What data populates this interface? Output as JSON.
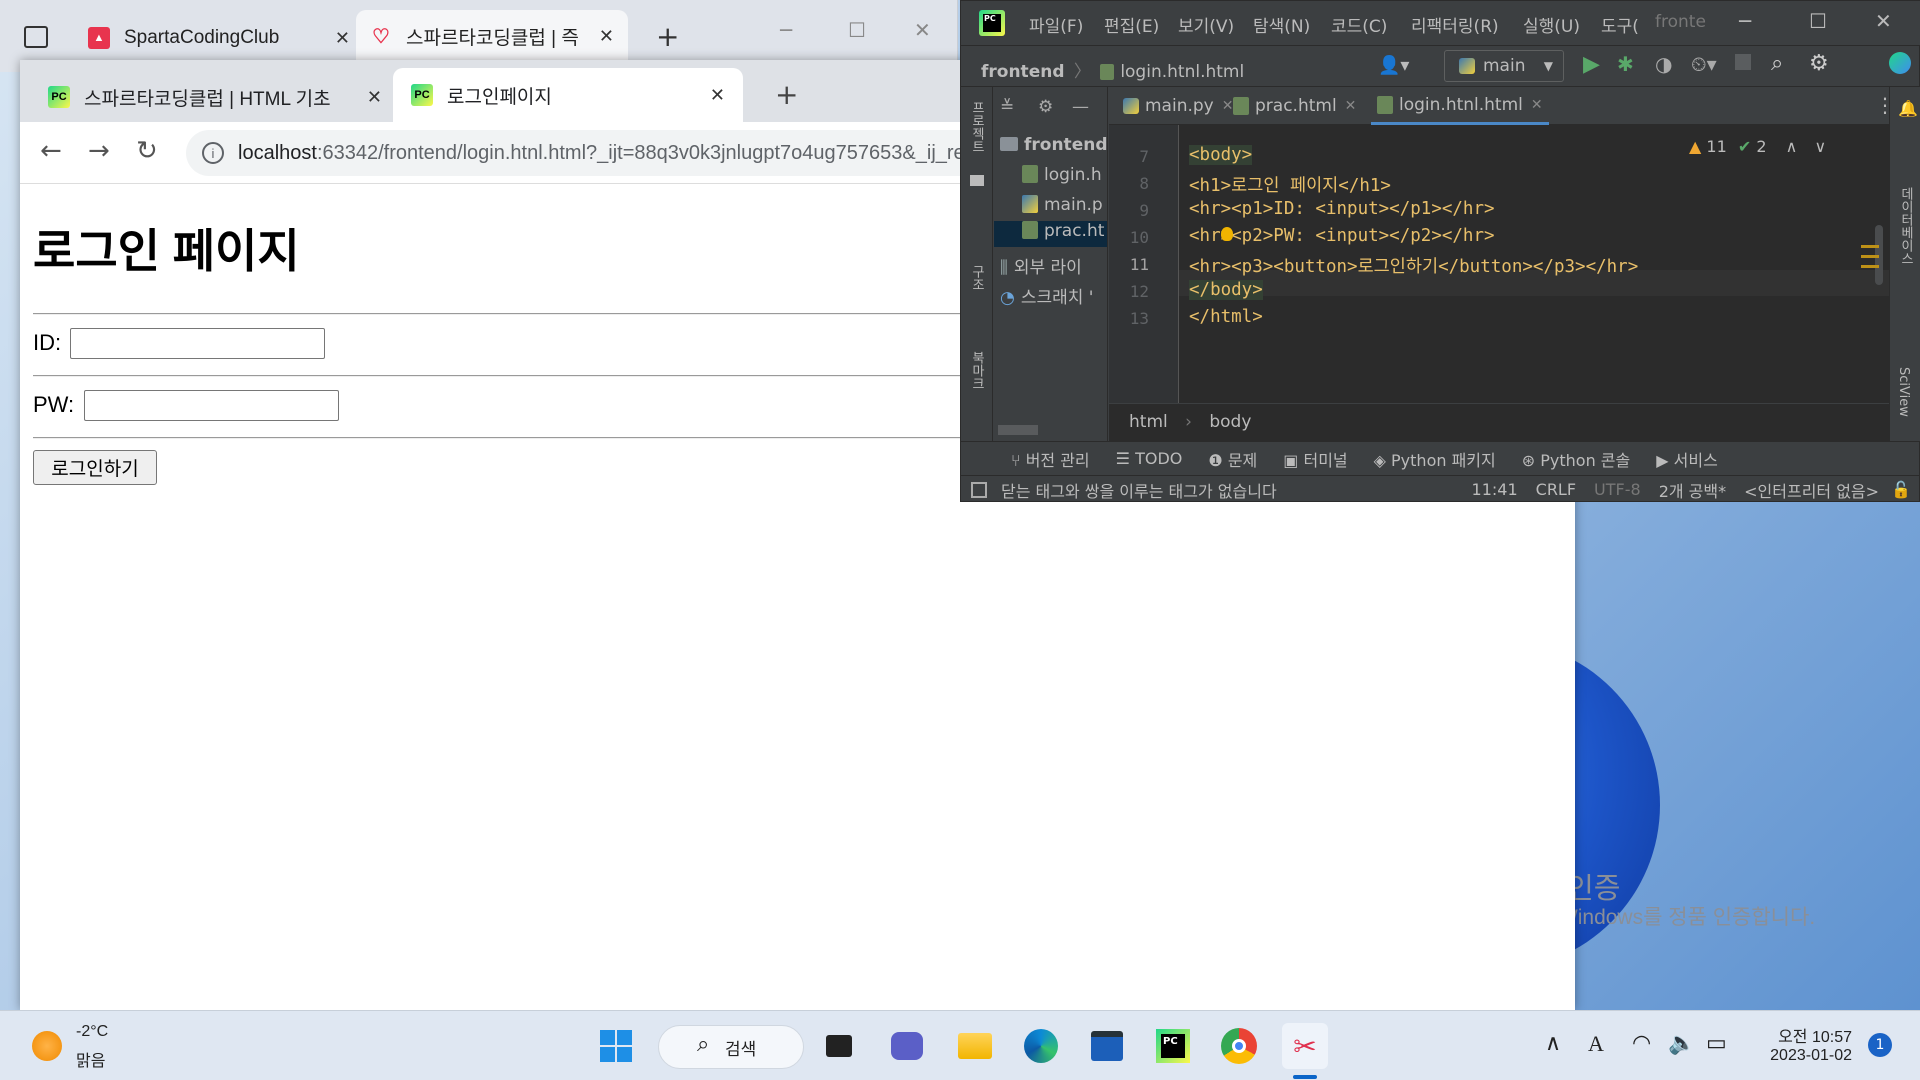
{
  "desktop": {
    "watermark_title": "Windows 정품 인증",
    "watermark_text": "[설정]으로 이동하여 Windows를 정품 인증합니다."
  },
  "back_browser": {
    "tabs": [
      {
        "label": "SpartaCodingClub",
        "icon": "sparta-favicon"
      },
      {
        "label": "스파르타코딩클럽 | 즉",
        "icon": "sparta-heart-favicon"
      }
    ]
  },
  "browser": {
    "tabs": [
      {
        "label": "스파르타코딩클럽 | HTML 기초",
        "icon": "pycharm-favicon"
      },
      {
        "label": "로그인페이지",
        "icon": "pycharm-favicon"
      }
    ],
    "url_host": "localhost",
    "url_rest": ":63342/frontend/login.htnl.html?_ijt=88q3v0k3jnlugpt7o4ug757653&_ij_reload=RELOAD_ON_SAVE"
  },
  "page": {
    "heading": "로그인 페이지",
    "id_label": "ID:",
    "pw_label": "PW:",
    "login_button": "로그인하기"
  },
  "pycharm": {
    "menu": [
      "파일(F)",
      "편집(E)",
      "보기(V)",
      "탐색(N)",
      "코드(C)",
      "리팩터링(R)",
      "실행(U)",
      "도구("
    ],
    "title_trunc": "fronte",
    "breadcrumb_project": "frontend",
    "breadcrumb_file": "login.htnl.html",
    "run_config": "main",
    "project_strip_label": "프로젝트",
    "structure_strip_label": "구조",
    "bookmark_strip_label": "북마크",
    "database_strip_label": "데이터베이스",
    "sciview_strip_label": "SciView",
    "tree": {
      "root": "frontend",
      "files": [
        "login.h",
        "main.p",
        "prac.ht"
      ],
      "external": "외부 라이",
      "scratch": "스크래치 '"
    },
    "editor_tabs": [
      "main.py",
      "prac.html",
      "login.htnl.html"
    ],
    "line_numbers": [
      "7",
      "8",
      "9",
      "10",
      "11",
      "12",
      "13"
    ],
    "code_lines": [
      "<body>",
      "<h1>로그인 페이지</h1>",
      "<hr><p1>ID: <input></p1></hr>",
      "<hr><p2>PW: <input></p2></hr>",
      "<hr><p3><button>로그인하기</button></p3></hr>",
      "</body>",
      "</html>"
    ],
    "warnings": "11",
    "checks": "2",
    "editor_breadcrumb": [
      "html",
      "body"
    ],
    "tool_windows": [
      "버전 관리",
      "TODO",
      "문제",
      "터미널",
      "Python 패키지",
      "Python 콘솔",
      "서비스"
    ],
    "status_message": "닫는 태그와 쌍을 이루는 태그가 없습니다",
    "cursor_pos": "11:41",
    "line_sep": "CRLF",
    "encoding": "UTF-8",
    "indent": "2개 공백*",
    "interpreter": "<인터프리터 없음>"
  },
  "taskbar": {
    "temp": "-2°C",
    "weather": "맑음",
    "search_label": "검색",
    "time": "오전 10:57",
    "date": "2023-01-02",
    "notif_count": "1",
    "ime": "A"
  }
}
